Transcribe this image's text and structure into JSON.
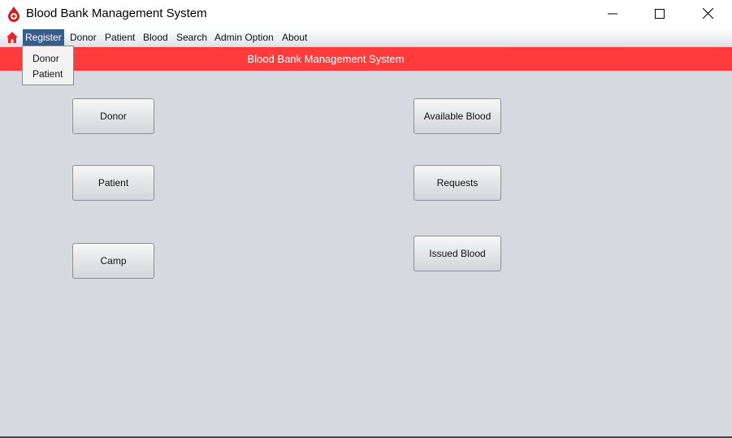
{
  "window": {
    "title": "Blood Bank Management System",
    "controls": {
      "minimize": "—",
      "maximize": "☐",
      "close": "✕"
    }
  },
  "menubar": {
    "items": [
      {
        "label": "Register",
        "active": true
      },
      {
        "label": "Donor"
      },
      {
        "label": "Patient"
      },
      {
        "label": "Blood"
      },
      {
        "label": "Search"
      },
      {
        "label": "Admin Option"
      },
      {
        "label": "About"
      }
    ],
    "home_icon": "home-icon"
  },
  "register_menu": {
    "items": [
      "Donor",
      "Patient"
    ]
  },
  "banner": {
    "title": "Blood Bank Management System",
    "color": "#ff3b3b"
  },
  "buttons": {
    "donor": "Donor",
    "patient": "Patient",
    "camp": "Camp",
    "available_blood": "Available Blood",
    "requests": "Requests",
    "issued_blood": "Issued Blood"
  },
  "colors": {
    "accent": "#365d8c",
    "background": "#d6d9e0",
    "banner": "#ff3b3b"
  }
}
